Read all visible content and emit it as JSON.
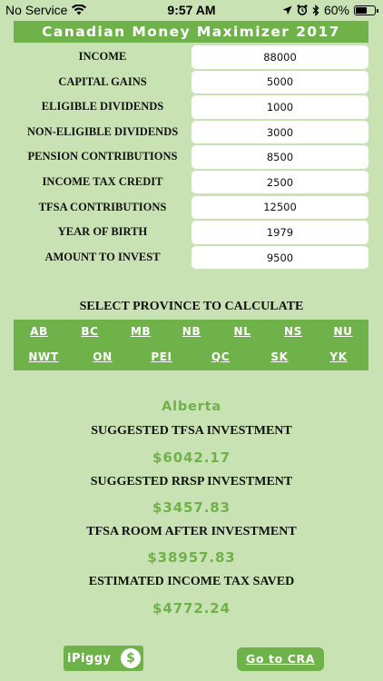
{
  "status_bar": {
    "carrier": "No Service",
    "time": "9:57 AM",
    "battery": "60%",
    "battery_level": 0.6,
    "icons": [
      "wifi-icon",
      "location-icon",
      "alarm-icon",
      "bluetooth-icon",
      "battery-icon"
    ]
  },
  "header": {
    "title": "Canadian Money Maximizer 2017"
  },
  "form": {
    "rows": [
      {
        "label": "INCOME",
        "value": "88000"
      },
      {
        "label": "CAPITAL GAINS",
        "value": "5000"
      },
      {
        "label": "ELIGIBLE DIVIDENDS",
        "value": "1000"
      },
      {
        "label": "NON-ELIGIBLE DIVIDENDS",
        "value": "3000"
      },
      {
        "label": "PENSION CONTRIBUTIONS",
        "value": "8500"
      },
      {
        "label": "INCOME TAX CREDIT",
        "value": "2500"
      },
      {
        "label": "TFSA CONTRIBUTIONS",
        "value": "12500"
      },
      {
        "label": "YEAR OF BIRTH",
        "value": "1979"
      },
      {
        "label": "AMOUNT TO INVEST",
        "value": "9500"
      }
    ]
  },
  "province_selector": {
    "title": "SELECT PROVINCE TO CALCULATE",
    "row1": [
      "AB",
      "BC",
      "MB",
      "NB",
      "NL",
      "NS",
      "NU"
    ],
    "row2": [
      "NWT",
      "ON",
      "PEI",
      "QC",
      "SK",
      "YK"
    ]
  },
  "results": {
    "province": "Alberta",
    "items": [
      {
        "label": "SUGGESTED TFSA INVESTMENT",
        "value": "$6042.17"
      },
      {
        "label": "SUGGESTED RRSP INVESTMENT",
        "value": "$3457.83"
      },
      {
        "label": "TFSA ROOM AFTER INVESTMENT",
        "value": "$38957.83"
      },
      {
        "label": "ESTIMATED INCOME TAX SAVED",
        "value": "$4772.24"
      }
    ]
  },
  "footer": {
    "logo_text": "iPiggy",
    "logo_symbol": "$",
    "cra_button": "Go to CRA"
  },
  "colors": {
    "background": "#c8e2b4",
    "accent": "#6fb24a",
    "text": "#111111",
    "input_bg": "#ffffff"
  }
}
